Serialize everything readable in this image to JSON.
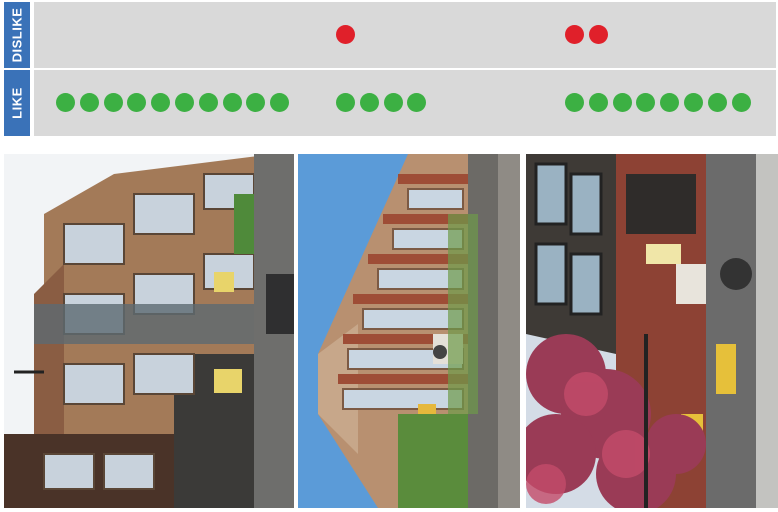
{
  "rows": {
    "dislike": {
      "label": "DISLIKE",
      "color": "#e0202a",
      "groups": [
        {
          "photo": 1,
          "count": 0
        },
        {
          "photo": 2,
          "count": 1
        },
        {
          "photo": 3,
          "count": 2
        }
      ]
    },
    "like": {
      "label": "LIKE",
      "color": "#3cb043",
      "groups": [
        {
          "photo": 1,
          "count": 10
        },
        {
          "photo": 2,
          "count": 4
        },
        {
          "photo": 3,
          "count": 8
        }
      ]
    }
  },
  "label_color": "#3a72b8",
  "photos": [
    {
      "subject": "brick-corner-building"
    },
    {
      "subject": "tall-mixed-use-building"
    },
    {
      "subject": "street-view-storefronts"
    }
  ]
}
